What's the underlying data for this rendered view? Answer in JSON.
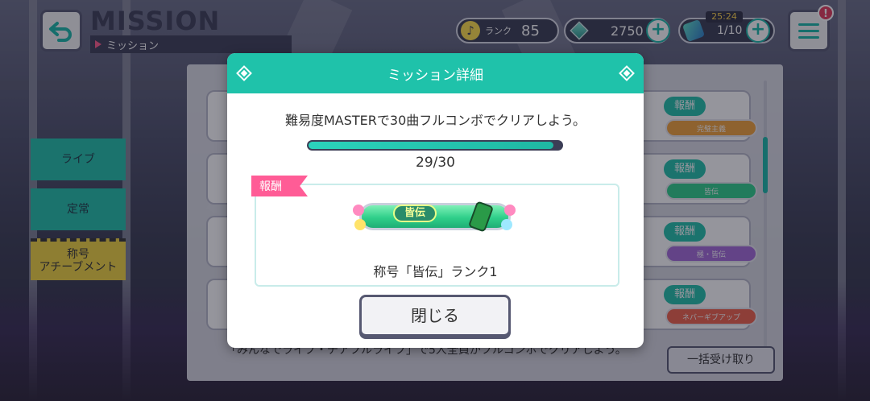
{
  "header": {
    "title_en": "MISSION",
    "title_jp": "ミッション",
    "rank_label": "ランク",
    "rank_value": "85",
    "gems": "2750",
    "ticket_timer": "25:24",
    "tickets": "1/10",
    "notification_badge": "!"
  },
  "sidebar": {
    "items": [
      {
        "label": "ライブ"
      },
      {
        "label": "定常"
      },
      {
        "label": "称号\nアチーブメント"
      }
    ]
  },
  "list": {
    "reward_label": "報酬",
    "reward_titles": [
      "完璧主義",
      "皆伝",
      "極・皆伝",
      "ネバーギブアップ"
    ],
    "bottom_text": "「みんなでライブ・チアフルライブ」で5人全員がフルコンボでクリアしよう。",
    "collect_all_label": "一括受け取り"
  },
  "modal": {
    "title": "ミッション詳細",
    "description": "難易度MASTERで30曲フルコンボでクリアしよう。",
    "progress_text": "29/30",
    "progress_fraction": 0.967,
    "reward_tag": "報酬",
    "plate_label": "皆伝",
    "reward_name": "称号「皆伝」ランク1",
    "close_label": "閉じる"
  },
  "colors": {
    "accent_teal": "#1fc2aa",
    "pink_tag": "#ff5c96",
    "navy": "#3c3e56",
    "tab_yellow": "#f3d63f"
  }
}
